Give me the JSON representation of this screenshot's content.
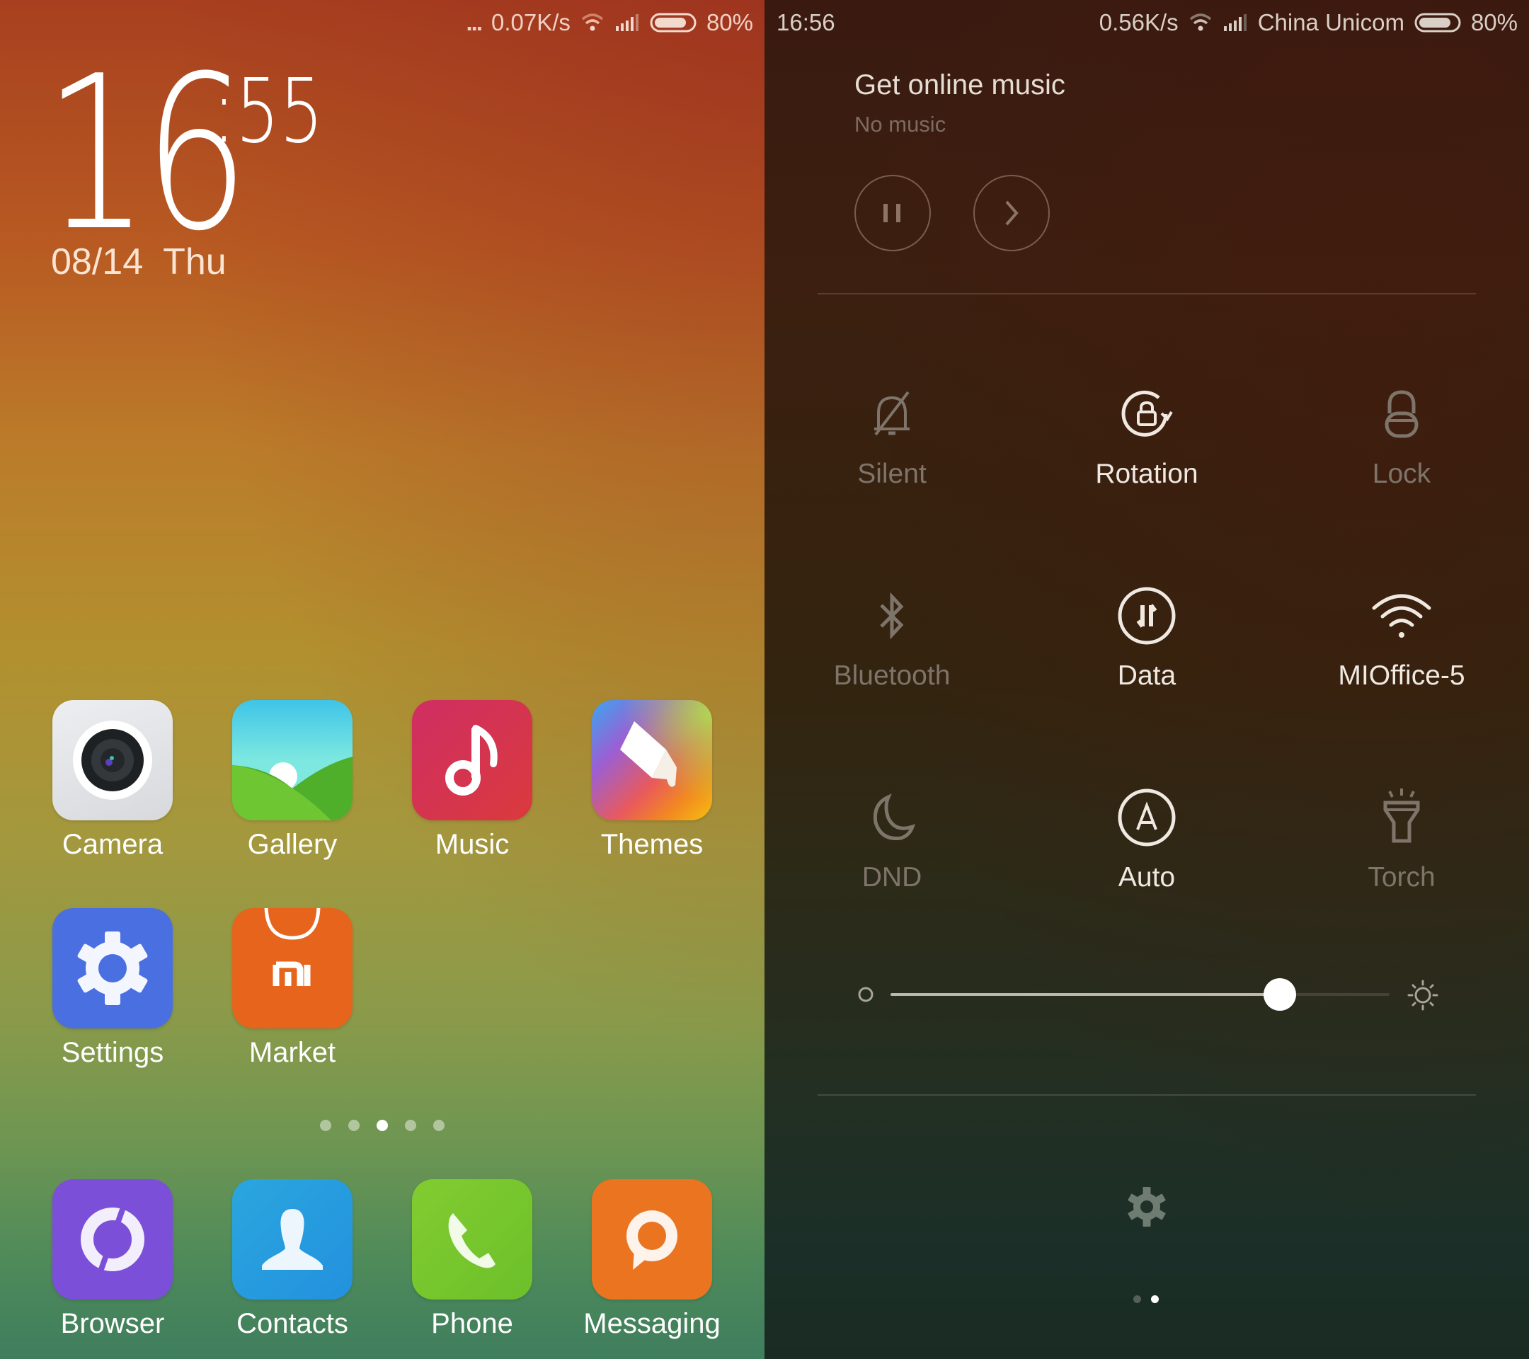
{
  "home_screen": {
    "status_bar": {
      "notification_dots": "...",
      "net_speed": "0.07K/s",
      "battery": "80%",
      "battery_level": 0.8
    },
    "clock": {
      "hour": "16",
      "minute": ":55"
    },
    "date": "08/14  Thu",
    "apps": [
      {
        "label": "Camera",
        "icon": "camera-icon",
        "color": "#e2e3e6"
      },
      {
        "label": "Gallery",
        "icon": "gallery-icon",
        "color": "#5cc8e0"
      },
      {
        "label": "Music",
        "icon": "music-icon",
        "color": "#d1344e"
      },
      {
        "label": "Themes",
        "icon": "themes-icon",
        "color": "#f07030"
      },
      {
        "label": "Settings",
        "icon": "settings-icon",
        "color": "#4a6fe0"
      },
      {
        "label": "Market",
        "icon": "market-icon",
        "color": "#e6641c"
      }
    ],
    "page_indicator": {
      "count": 5,
      "active": 3
    },
    "dock": [
      {
        "label": "Browser",
        "icon": "browser-icon",
        "color": "#7b4fd8"
      },
      {
        "label": "Contacts",
        "icon": "contacts-icon",
        "color": "#269fde"
      },
      {
        "label": "Phone",
        "icon": "phone-icon",
        "color": "#72c42c"
      },
      {
        "label": "Messaging",
        "icon": "messaging-icon",
        "color": "#ea7420"
      }
    ]
  },
  "notification_shade": {
    "status_bar": {
      "time": "16:56",
      "net_speed": "0.56K/s",
      "carrier": "China Unicom",
      "battery": "80%",
      "battery_level": 0.8
    },
    "music": {
      "title": "Get online music",
      "subtitle": "No music"
    },
    "toggles": [
      {
        "label": "Silent",
        "icon": "bell-off-icon",
        "active": false
      },
      {
        "label": "Rotation",
        "icon": "rotation-lock-icon",
        "active": true
      },
      {
        "label": "Lock",
        "icon": "lock-icon",
        "active": false
      },
      {
        "label": "Bluetooth",
        "icon": "bluetooth-icon",
        "active": false
      },
      {
        "label": "Data",
        "icon": "data-icon",
        "active": true
      },
      {
        "label": "MIOffice-5",
        "icon": "wifi-icon",
        "active": true
      },
      {
        "label": "DND",
        "icon": "moon-icon",
        "active": false
      },
      {
        "label": "Auto",
        "icon": "auto-brightness-icon",
        "active": true
      },
      {
        "label": "Torch",
        "icon": "torch-icon",
        "active": false
      }
    ],
    "brightness": {
      "value": 0.78
    },
    "page_indicator": {
      "count": 2,
      "active": 2
    }
  }
}
